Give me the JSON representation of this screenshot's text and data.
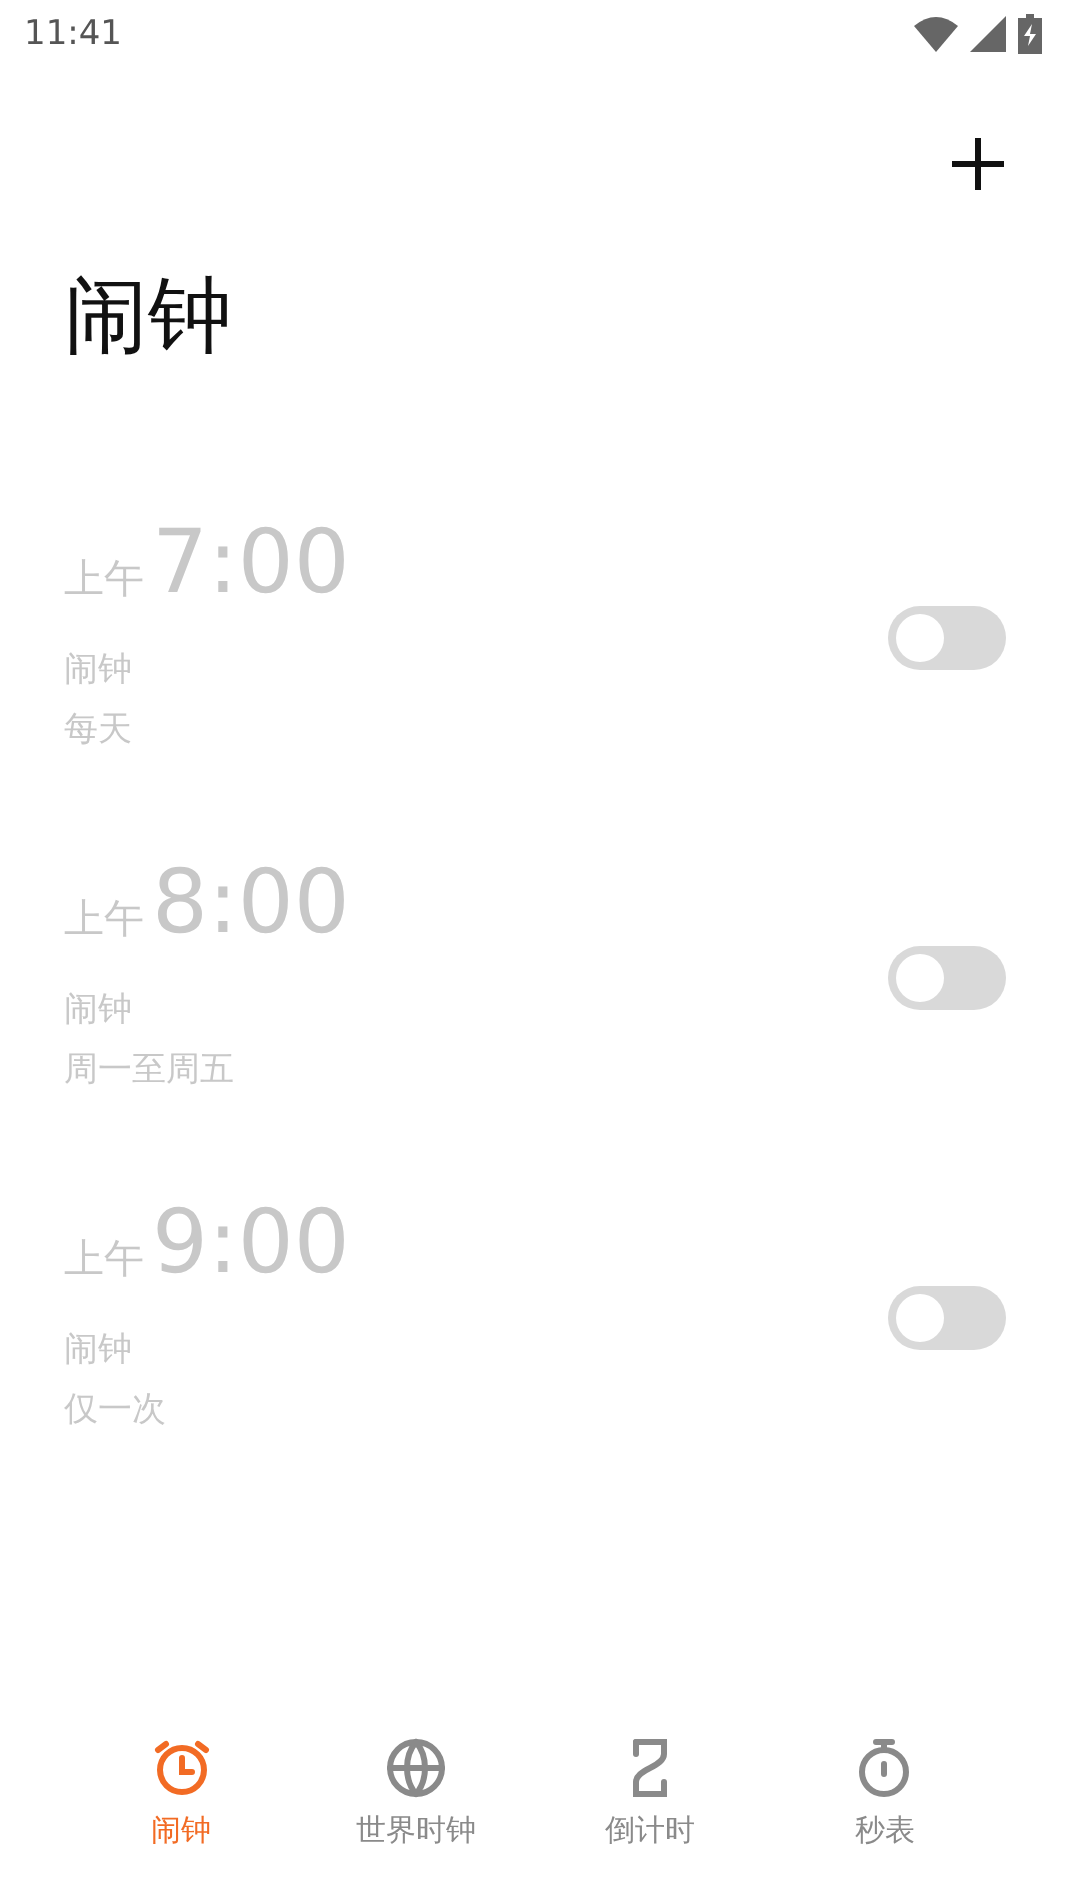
{
  "status_bar": {
    "time": "11:41"
  },
  "title": "闹钟",
  "alarms": [
    {
      "period": "上午",
      "time": "7:00",
      "label": "闹钟",
      "repeat": "每天",
      "on": false
    },
    {
      "period": "上午",
      "time": "8:00",
      "label": "闹钟",
      "repeat": "周一至周五",
      "on": false
    },
    {
      "period": "上午",
      "time": "9:00",
      "label": "闹钟",
      "repeat": "仅一次",
      "on": false
    }
  ],
  "tabs": [
    {
      "kind": "alarm",
      "label": "闹钟",
      "selected": true
    },
    {
      "kind": "globe",
      "label": "世界时钟",
      "selected": false
    },
    {
      "kind": "hourglass",
      "label": "倒计时",
      "selected": false
    },
    {
      "kind": "stopwatch",
      "label": "秒表",
      "selected": false
    }
  ]
}
